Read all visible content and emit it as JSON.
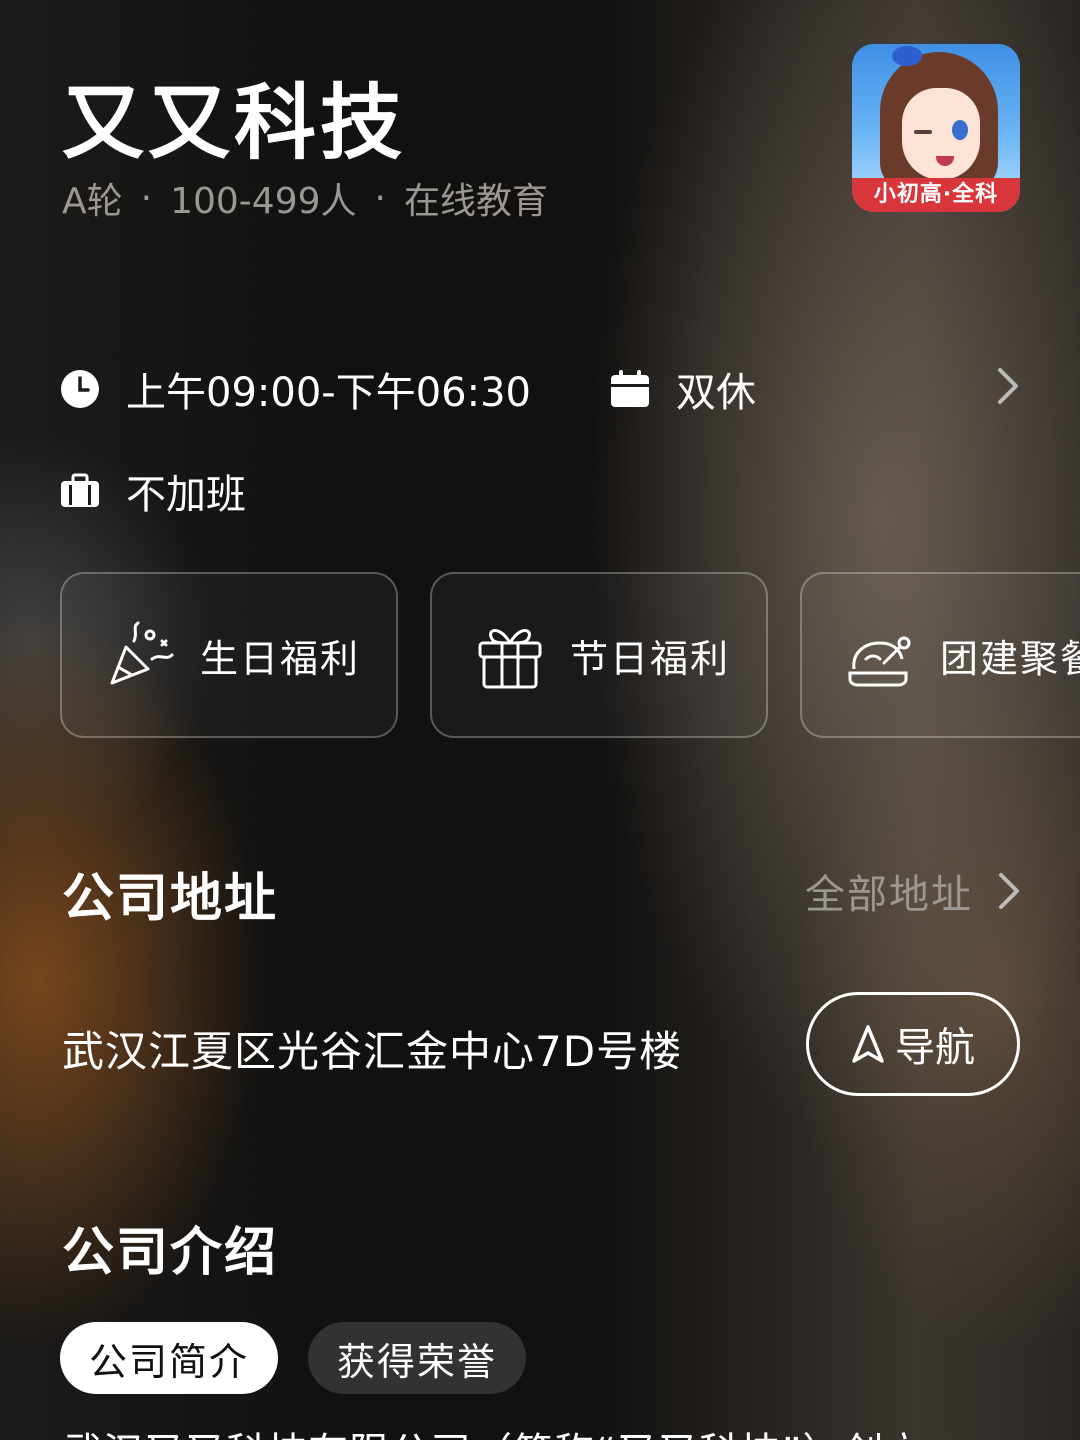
{
  "company": {
    "name": "又又科技",
    "stage": "A轮",
    "size": "100-499人",
    "industry": "在线教育",
    "separator": "·",
    "logo_badge": "小初高·全科"
  },
  "work": {
    "hours": "上午09:00-下午06:30",
    "rest": "双休",
    "overtime": "不加班"
  },
  "benefits": [
    {
      "label": "生日福利",
      "icon": "party-popper-icon"
    },
    {
      "label": "节日福利",
      "icon": "gift-icon"
    },
    {
      "label": "团建聚餐",
      "icon": "roast-chicken-icon"
    }
  ],
  "address_section": {
    "title": "公司地址",
    "all_link": "全部地址",
    "address": "武汉江夏区光谷汇金中心7D号楼",
    "nav_label": "导航"
  },
  "intro_section": {
    "title": "公司介绍",
    "tabs": [
      {
        "label": "公司简介",
        "active": true
      },
      {
        "label": "获得荣誉",
        "active": false
      }
    ],
    "text_preview": "武汉又又科技有限公司（简称“又又科技”）创立"
  },
  "colors": {
    "text_primary": "#ffffff",
    "text_secondary": "#9b9893",
    "logo_badge_bg": "#d8363b"
  }
}
